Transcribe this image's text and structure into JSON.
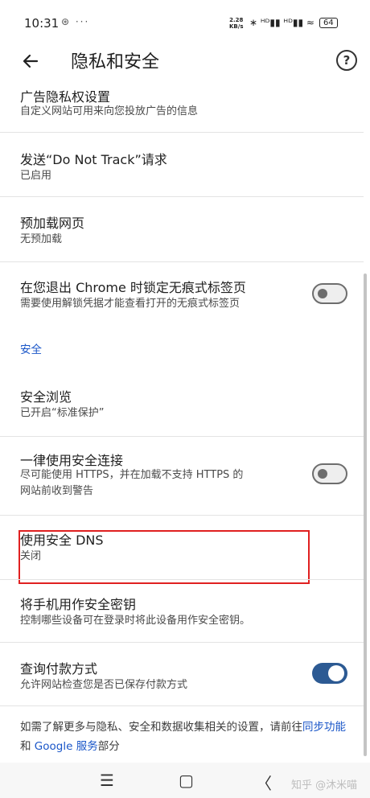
{
  "status_bar": {
    "time": "10:31",
    "left_icons": "⊛ ···",
    "speed_value": "2.28",
    "speed_unit": "KB/s",
    "right_icons": "∗ ᴴᴰ▮▮ ᴴᴰ▮▮ ≈",
    "battery": "64"
  },
  "app_bar": {
    "title": "隐私和安全"
  },
  "settings": {
    "ad_privacy": {
      "title": "广告隐私权设置",
      "subtitle": "自定义网站可用来向您投放广告的信息"
    },
    "do_not_track": {
      "title": "发送“Do Not Track”请求",
      "subtitle": "已启用"
    },
    "preload": {
      "title": "预加载网页",
      "subtitle": "无预加载"
    },
    "lock_incognito": {
      "title": "在您退出 Chrome 时锁定无痕式标签页",
      "subtitle": "需要使用解锁凭据才能查看打开的无痕式标签页",
      "enabled": false
    },
    "section_security": "安全",
    "safe_browsing": {
      "title": "安全浏览",
      "subtitle": "已开启“标准保护”"
    },
    "https_first": {
      "title": "一律使用安全连接",
      "subtitle_line1": "尽可能使用 HTTPS，并在加载不支持 HTTPS 的",
      "subtitle_line2": "网站前收到警告",
      "enabled": false
    },
    "secure_dns": {
      "title": "使用安全 DNS",
      "subtitle": "关闭"
    },
    "phone_key": {
      "title": "将手机用作安全密钥",
      "subtitle": "控制哪些设备可在登录时将此设备用作安全密钥。"
    },
    "payment_methods": {
      "title": "查询付款方式",
      "subtitle": "允许网站检查您是否已保存付款方式",
      "enabled": true
    }
  },
  "footer": {
    "text_before": "如需了解更多与隐私、安全和数据收集相关的设置，请前往",
    "link1": "同步功能",
    "text_middle": "和 ",
    "link2": "Google 服务",
    "text_after": "部分"
  },
  "nav_bar": {
    "menu": "☰",
    "home": "▢",
    "back": "〈"
  },
  "watermark": "知乎 @沐米喵",
  "colors": {
    "accent": "#1a56c8",
    "toggle_on": "#2c5a93",
    "highlight": "#e02020"
  }
}
